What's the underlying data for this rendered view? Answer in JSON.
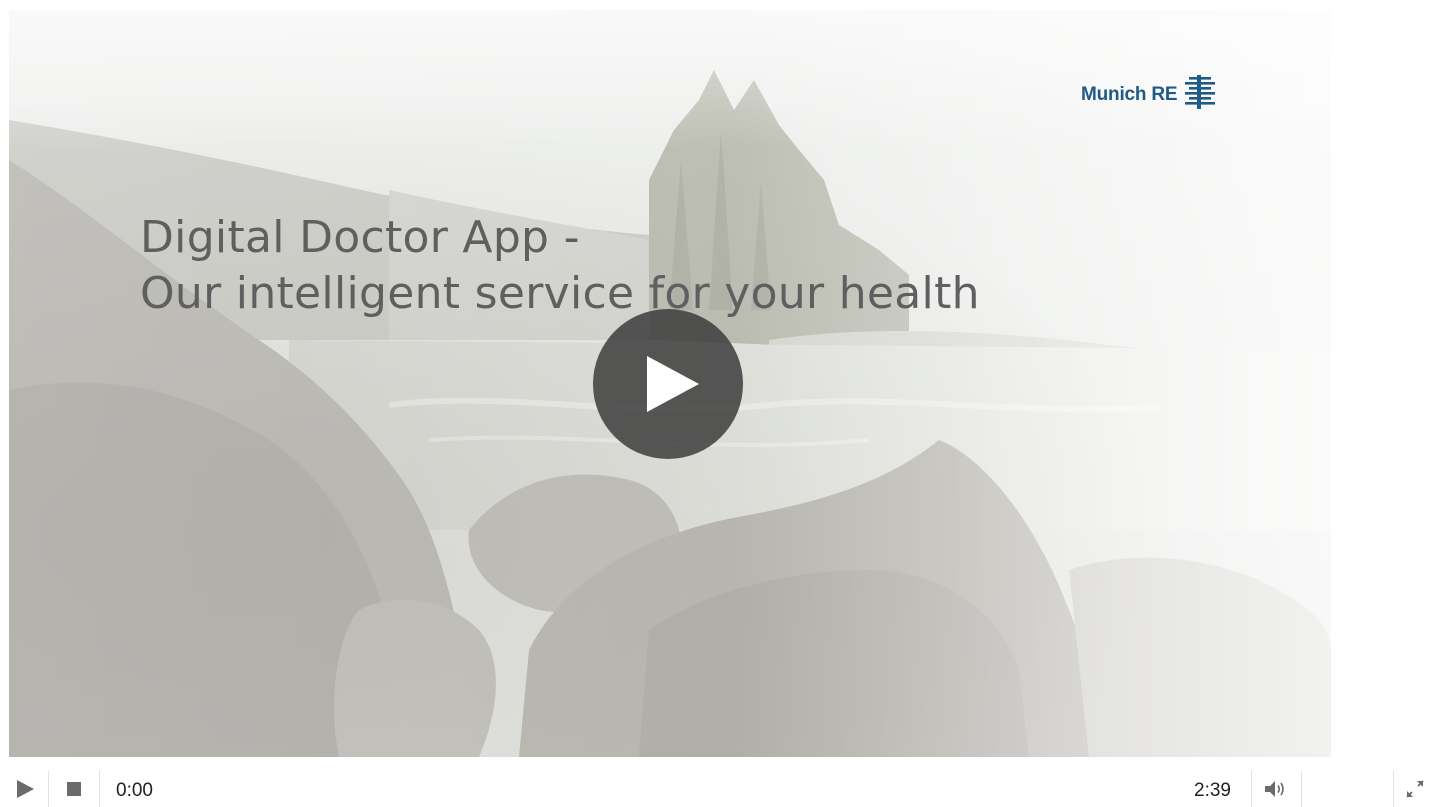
{
  "video": {
    "brand": "Munich RE",
    "title_line1": "Digital Doctor App -",
    "title_line2": "Our intelligent service for your health",
    "play_overlay_icon": "play-icon"
  },
  "controls": {
    "play_icon": "play-icon",
    "stop_icon": "stop-icon",
    "current_time": "0:00",
    "duration": "2:39",
    "volume_icon": "volume-icon",
    "fullscreen_icon": "fullscreen-icon",
    "progress": 0
  },
  "colors": {
    "brand": "#1e5b86",
    "title": "#5f5f5f",
    "overlay": "#3c3c3c",
    "control_icon": "#6b6b6b"
  }
}
